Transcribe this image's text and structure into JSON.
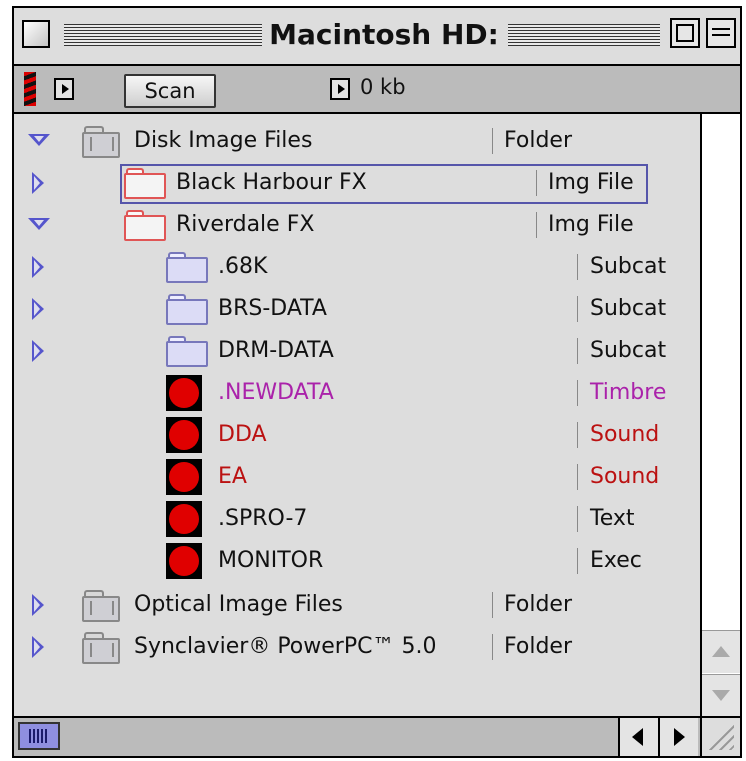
{
  "window": {
    "title": "Macintosh HD:"
  },
  "toolbar": {
    "scan_label": "Scan",
    "size_text": "0 kb"
  },
  "rows": [
    {
      "name": "Disk Image Files",
      "kind": "Folder",
      "expanded": true,
      "icon": "grey-folder-icon",
      "color": "#111111"
    },
    {
      "name": "Black Harbour FX",
      "kind": "Img File",
      "expanded": false,
      "selected": true,
      "icon": "image-file-folder-icon",
      "color": "#111111"
    },
    {
      "name": "Riverdale FX",
      "kind": "Img File",
      "expanded": true,
      "icon": "image-file-folder-icon",
      "color": "#111111"
    },
    {
      "name": ".68K",
      "kind": "Subcat",
      "expanded": false,
      "icon": "subcat-folder-icon",
      "color": "#111111"
    },
    {
      "name": "BRS-DATA",
      "kind": "Subcat",
      "expanded": false,
      "icon": "subcat-folder-icon",
      "color": "#111111"
    },
    {
      "name": "DRM-DATA",
      "kind": "Subcat",
      "expanded": false,
      "icon": "subcat-folder-icon",
      "color": "#111111"
    },
    {
      "name": ".NEWDATA",
      "kind": "Timbre",
      "icon": "red-dot-file-icon",
      "color": "#aa22aa"
    },
    {
      "name": "DDA",
      "kind": "Sound",
      "icon": "red-dot-file-icon",
      "color": "#bb1111"
    },
    {
      "name": "EA",
      "kind": "Sound",
      "icon": "red-dot-file-icon",
      "color": "#bb1111"
    },
    {
      "name": ".SPRO-7",
      "kind": "Text",
      "icon": "red-dot-file-icon",
      "color": "#111111"
    },
    {
      "name": "MONITOR",
      "kind": "Exec",
      "icon": "red-dot-file-icon",
      "color": "#111111"
    },
    {
      "name": "Optical Image Files",
      "kind": "Folder",
      "expanded": false,
      "icon": "grey-folder-icon",
      "color": "#111111"
    },
    {
      "name": "Synclavier® PowerPC™ 5.0",
      "kind": "Folder",
      "expanded": false,
      "icon": "grey-folder-icon",
      "color": "#111111"
    }
  ]
}
